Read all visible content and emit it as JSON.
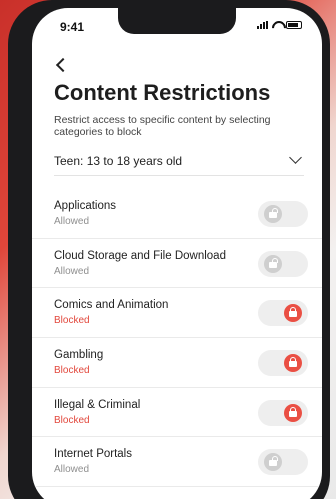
{
  "status": {
    "time": "9:41"
  },
  "header": {
    "title": "Content Restrictions",
    "subtitle": "Restrict access to specific content by selecting categories to block"
  },
  "age_filter": {
    "selected": "Teen: 13 to 18 years old"
  },
  "categories": [
    {
      "name": "Applications",
      "state": "Allowed"
    },
    {
      "name": "Cloud Storage and File Download",
      "state": "Allowed"
    },
    {
      "name": "Comics and Animation",
      "state": "Blocked"
    },
    {
      "name": "Gambling",
      "state": "Blocked"
    },
    {
      "name": "Illegal & Criminal",
      "state": "Blocked"
    },
    {
      "name": "Internet Portals",
      "state": "Allowed"
    }
  ],
  "colors": {
    "accent": "#ea4f43",
    "blocked_text": "#e2483d",
    "allowed_text": "#8f8f8f"
  }
}
